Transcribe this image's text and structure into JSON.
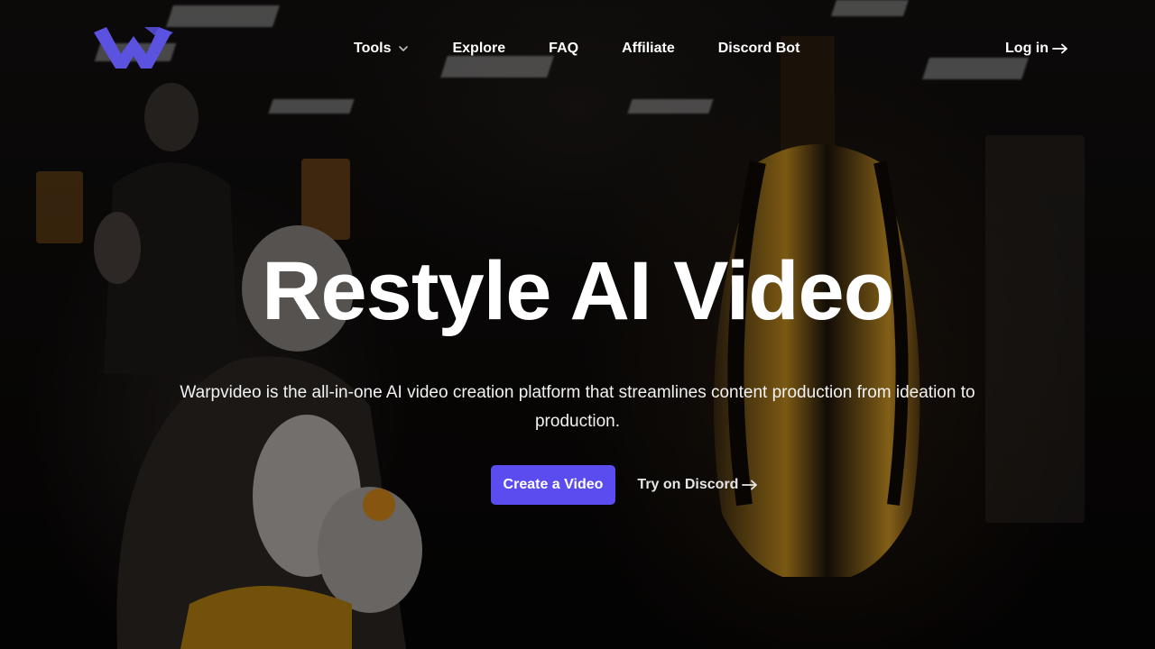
{
  "nav": {
    "logo_icon": "warpvideo-w-logo-icon",
    "links": [
      {
        "label": "Tools",
        "has_dropdown": true
      },
      {
        "label": "Explore"
      },
      {
        "label": "FAQ"
      },
      {
        "label": "Affiliate"
      },
      {
        "label": "Discord Bot"
      }
    ],
    "login_label": "Log in"
  },
  "hero": {
    "title": "Restyle AI Video",
    "subtitle": "Warpvideo is the all-in-one AI video creation platform that streamlines content production from ideation to production.",
    "primary_cta": "Create a Video",
    "secondary_cta": "Try on Discord"
  },
  "colors": {
    "accent": "#5b4cf0",
    "logo": "#5b52e0",
    "text": "#ffffff"
  }
}
